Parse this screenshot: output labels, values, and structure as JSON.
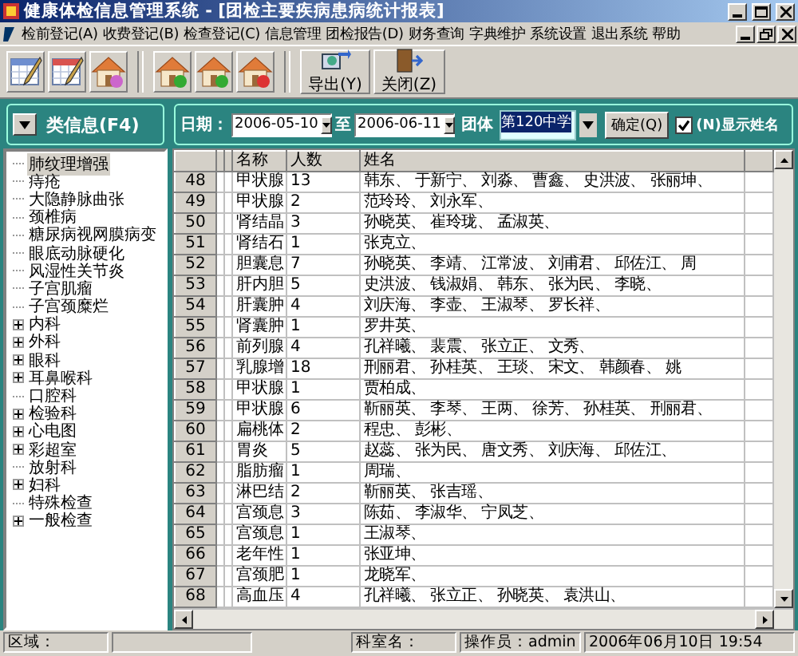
{
  "window": {
    "title": "健康体检信息管理系统 - [团检主要疾病患病统计报表]"
  },
  "menu": [
    {
      "label": "检前登记(A)"
    },
    {
      "label": "收费登记(B)"
    },
    {
      "label": "检查登记(C)"
    },
    {
      "label": "信息管理"
    },
    {
      "label": "团检报告(D)"
    },
    {
      "label": "财务查询"
    },
    {
      "label": "字典维护"
    },
    {
      "label": "系统设置"
    },
    {
      "label": "退出系统"
    },
    {
      "label": "帮助"
    }
  ],
  "toolbar": {
    "buttons": [
      {
        "label": "导出(Y)"
      },
      {
        "label": "关闭(Z)"
      }
    ]
  },
  "tree": {
    "button": "类信息(F4)",
    "items": [
      {
        "label": "肺纹理增强",
        "selected": true,
        "expandable": false
      },
      {
        "label": "痔疮",
        "selected": false,
        "expandable": false
      },
      {
        "label": "大隐静脉曲张",
        "selected": false,
        "expandable": false
      },
      {
        "label": "颈椎病",
        "selected": false,
        "expandable": false
      },
      {
        "label": "糖尿病视网膜病变",
        "selected": false,
        "expandable": false
      },
      {
        "label": "眼底动脉硬化",
        "selected": false,
        "expandable": false
      },
      {
        "label": "风湿性关节炎",
        "selected": false,
        "expandable": false
      },
      {
        "label": "子宫肌瘤",
        "selected": false,
        "expandable": false
      },
      {
        "label": "子宫颈糜烂",
        "selected": false,
        "expandable": false
      },
      {
        "label": "内科",
        "selected": false,
        "expandable": true
      },
      {
        "label": "外科",
        "selected": false,
        "expandable": true
      },
      {
        "label": "眼科",
        "selected": false,
        "expandable": true
      },
      {
        "label": "耳鼻喉科",
        "selected": false,
        "expandable": true
      },
      {
        "label": "口腔科",
        "selected": false,
        "expandable": false
      },
      {
        "label": "检验科",
        "selected": false,
        "expandable": true
      },
      {
        "label": "心电图",
        "selected": false,
        "expandable": true
      },
      {
        "label": "彩超室",
        "selected": false,
        "expandable": true
      },
      {
        "label": "放射科",
        "selected": false,
        "expandable": false
      },
      {
        "label": "妇科",
        "selected": false,
        "expandable": true
      },
      {
        "label": "特殊检查",
        "selected": false,
        "expandable": false
      },
      {
        "label": "一般检查",
        "selected": false,
        "expandable": true
      }
    ]
  },
  "filter": {
    "date_label": "日期：",
    "date_from": "2006-05-10",
    "to_label": "至",
    "date_to": "2006-06-11",
    "group_label": "团体",
    "group_value": "第120中学",
    "ok_button": "确定(Q)",
    "show_names": {
      "label": "(N)显示姓名",
      "checked": true
    }
  },
  "table": {
    "columns": [
      "名称",
      "人数",
      "姓名"
    ],
    "rows": [
      {
        "index": "48",
        "name": "甲状腺",
        "count": "13",
        "people": "韩东、 于新宁、 刘淼、 曹鑫、 史洪波、 张丽坤、"
      },
      {
        "index": "49",
        "name": "甲状腺",
        "count": "2",
        "people": "范玲玲、 刘永军、"
      },
      {
        "index": "50",
        "name": "肾结晶",
        "count": "3",
        "people": "孙晓英、 崔玲珑、 孟淑英、"
      },
      {
        "index": "51",
        "name": "肾结石",
        "count": "1",
        "people": "张克立、"
      },
      {
        "index": "52",
        "name": "胆囊息",
        "count": "7",
        "people": "孙晓英、 李靖、 江常波、 刘甫君、 邱佐江、 周"
      },
      {
        "index": "53",
        "name": "肝内胆",
        "count": "5",
        "people": "史洪波、 钱淑娟、 韩东、 张为民、 李晓、"
      },
      {
        "index": "54",
        "name": "肝囊肿",
        "count": "4",
        "people": "刘庆海、 李壶、 王淑琴、 罗长祥、"
      },
      {
        "index": "55",
        "name": "肾囊肿",
        "count": "1",
        "people": "罗井英、"
      },
      {
        "index": "56",
        "name": "前列腺",
        "count": "4",
        "people": "孔祥曦、 裴震、 张立正、 文秀、"
      },
      {
        "index": "57",
        "name": "乳腺增",
        "count": "18",
        "people": "刑丽君、 孙桂英、 王琰、 宋文、 韩颜春、 姚"
      },
      {
        "index": "58",
        "name": "甲状腺",
        "count": "1",
        "people": "贾柏成、"
      },
      {
        "index": "59",
        "name": "甲状腺",
        "count": "6",
        "people": "靳丽英、 李琴、 王两、 徐芳、 孙桂英、 刑丽君、"
      },
      {
        "index": "60",
        "name": "扁桃体",
        "count": "2",
        "people": "程忠、 彭彬、"
      },
      {
        "index": "61",
        "name": "胃炎",
        "count": "5",
        "people": "赵蕊、 张为民、 唐文秀、 刘庆海、 邱佐江、"
      },
      {
        "index": "62",
        "name": "脂肪瘤",
        "count": "1",
        "people": "周瑞、"
      },
      {
        "index": "63",
        "name": "淋巴结",
        "count": "2",
        "people": "靳丽英、 张吉瑶、"
      },
      {
        "index": "64",
        "name": "宫颈息",
        "count": "3",
        "people": "陈茹、 李淑华、 宁凤芝、"
      },
      {
        "index": "65",
        "name": "宫颈息",
        "count": "1",
        "people": "王淑琴、"
      },
      {
        "index": "66",
        "name": "老年性",
        "count": "1",
        "people": "张亚坤、"
      },
      {
        "index": "67",
        "name": "宫颈肥",
        "count": "1",
        "people": "龙晓军、"
      },
      {
        "index": "68",
        "name": "高血压",
        "count": "4",
        "people": "孔祥曦、 张立正、 孙晓英、 袁洪山、"
      }
    ]
  },
  "status_bar": {
    "region_label": "区域：",
    "dept_label": "科室名：",
    "operator": "操作员：admin",
    "datetime": "2006年06月10日 19:54"
  }
}
